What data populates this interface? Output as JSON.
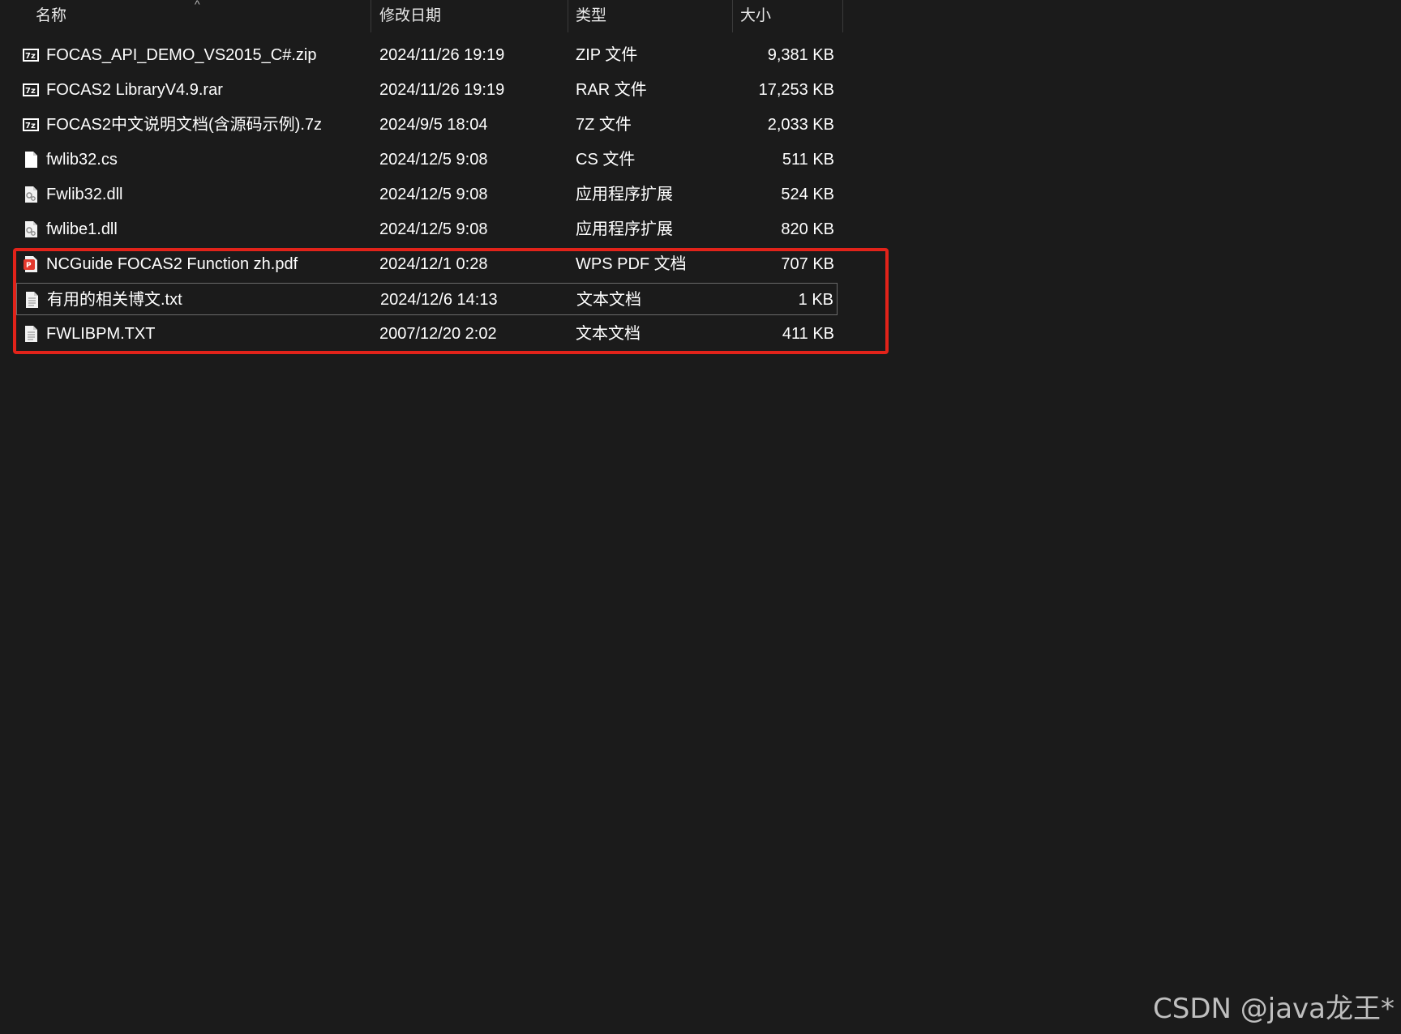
{
  "columns": {
    "name": "名称",
    "date": "修改日期",
    "type": "类型",
    "size": "大小"
  },
  "sort_indicator": "^",
  "files": [
    {
      "name": "FOCAS_API_DEMO_VS2015_C#.zip",
      "date": "2024/11/26 19:19",
      "type": "ZIP 文件",
      "size": "9,381 KB",
      "icon": "7z-archive-icon"
    },
    {
      "name": "FOCAS2 LibraryV4.9.rar",
      "date": "2024/11/26 19:19",
      "type": "RAR 文件",
      "size": "17,253 KB",
      "icon": "7z-archive-icon"
    },
    {
      "name": " FOCAS2中文说明文档(含源码示例).7z",
      "date": "2024/9/5 18:04",
      "type": "7Z 文件",
      "size": "2,033 KB",
      "icon": "7z-archive-icon"
    },
    {
      "name": "fwlib32.cs",
      "date": "2024/12/5 9:08",
      "type": "CS 文件",
      "size": "511 KB",
      "icon": "blank-file-icon"
    },
    {
      "name": "Fwlib32.dll",
      "date": "2024/12/5 9:08",
      "type": "应用程序扩展",
      "size": "524 KB",
      "icon": "dll-file-icon"
    },
    {
      "name": "fwlibe1.dll",
      "date": "2024/12/5 9:08",
      "type": "应用程序扩展",
      "size": "820 KB",
      "icon": "dll-file-icon"
    },
    {
      "name": "NCGuide FOCAS2 Function zh.pdf",
      "date": "2024/12/1 0:28",
      "type": "WPS PDF 文档",
      "size": "707 KB",
      "icon": "pdf-file-icon"
    },
    {
      "name": "有用的相关博文.txt",
      "date": "2024/12/6 14:13",
      "type": "文本文档",
      "size": "1 KB",
      "icon": "text-file-icon"
    },
    {
      "name": "FWLIBPM.TXT",
      "date": "2007/12/20 2:02",
      "type": "文本文档",
      "size": "411 KB",
      "icon": "text-file-icon"
    }
  ],
  "selected_index": 7,
  "highlight_color": "#e2231a",
  "watermark": "CSDN @java龙王*"
}
